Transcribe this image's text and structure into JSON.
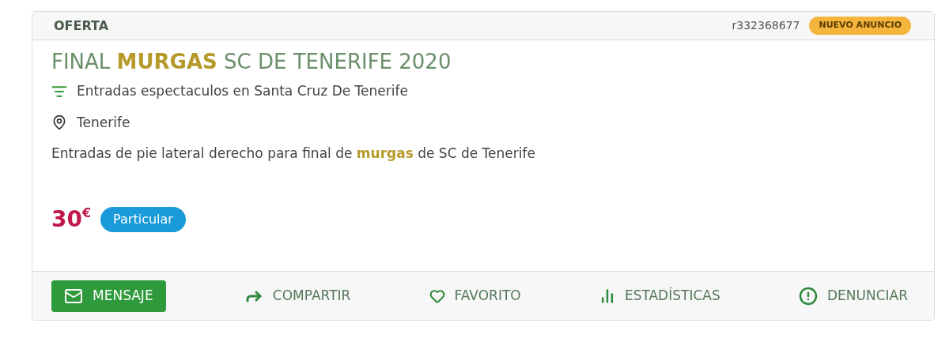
{
  "header": {
    "type": "OFERTA",
    "reference": "r332368677",
    "badge": "NUEVO ANUNCIO"
  },
  "title": "FINAL **MURGAS** SC DE TENERIFE 2020",
  "category": "Entradas espectaculos en Santa Cruz De Tenerife",
  "location": "Tenerife",
  "description": "Entradas de pie lateral derecho para final de **murgas** de SC de Tenerife",
  "price": {
    "amount": "30",
    "currency": "€"
  },
  "seller_tag": "Particular",
  "actions": [
    {
      "label": "MENSAJE",
      "kind": "primary"
    },
    {
      "label": "COMPARTIR",
      "kind": "link"
    },
    {
      "label": "FAVORITO",
      "kind": "link"
    },
    {
      "label": "ESTADÍSTICAS",
      "kind": "link"
    },
    {
      "label": "DENUNCIAR",
      "kind": "link"
    }
  ]
}
